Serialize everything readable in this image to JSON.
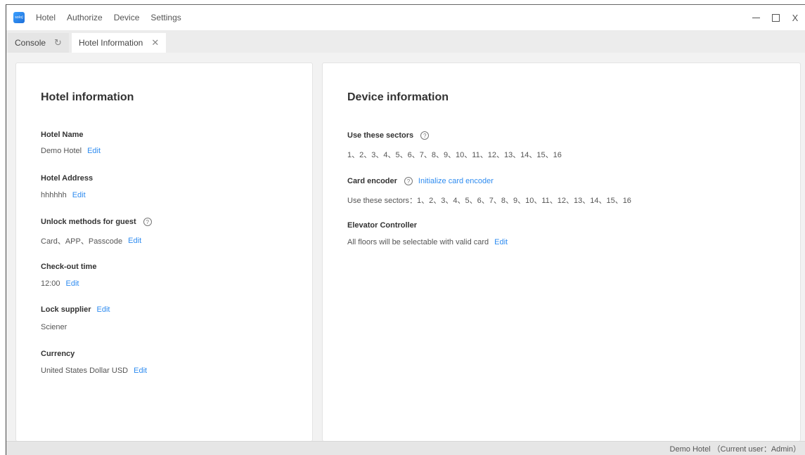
{
  "app": {
    "logo_text": "soloJ",
    "menu": [
      "Hotel",
      "Authorize",
      "Device",
      "Settings"
    ]
  },
  "window_controls": {
    "minimize": "minimize-icon",
    "maximize": "maximize-icon",
    "close": "X"
  },
  "tabs": [
    {
      "label": "Console",
      "icon": "refresh-icon",
      "icon_glyph": "↻",
      "active": false
    },
    {
      "label": "Hotel Information",
      "icon": "close-icon",
      "icon_glyph": "✕",
      "active": true
    }
  ],
  "hotel_panel": {
    "title": "Hotel information",
    "name_label": "Hotel Name",
    "name_value": "Demo Hotel",
    "address_label": "Hotel Address",
    "address_value": "hhhhhh",
    "unlock_label": "Unlock methods for guest",
    "unlock_value": "Card、APP、Passcode",
    "checkout_label": "Check-out time",
    "checkout_value": "12:00",
    "supplier_label": "Lock supplier",
    "supplier_value": "Sciener",
    "currency_label": "Currency",
    "currency_value": "United States Dollar USD",
    "edit_label": "Edit",
    "help_glyph": "?"
  },
  "device_panel": {
    "title": "Device information",
    "sectors_label": "Use these sectors",
    "sectors_value": "1、2、3、4、5、6、7、8、9、10、11、12、13、14、15、16",
    "encoder_label": "Card encoder",
    "encoder_link": "Initialize card encoder",
    "encoder_sectors": "Use these sectors：1、2、3、4、5、6、7、8、9、10、11、12、13、14、15、16",
    "elevator_label": "Elevator Controller",
    "elevator_value": "All floors will be selectable with valid card",
    "edit_label": "Edit",
    "help_glyph": "?"
  },
  "statusbar": {
    "text": "Demo Hotel （Current user：Admin）"
  },
  "colors": {
    "link": "#2f8cf0",
    "logo": "#2f8cf0",
    "background": "#f2f2f2"
  }
}
